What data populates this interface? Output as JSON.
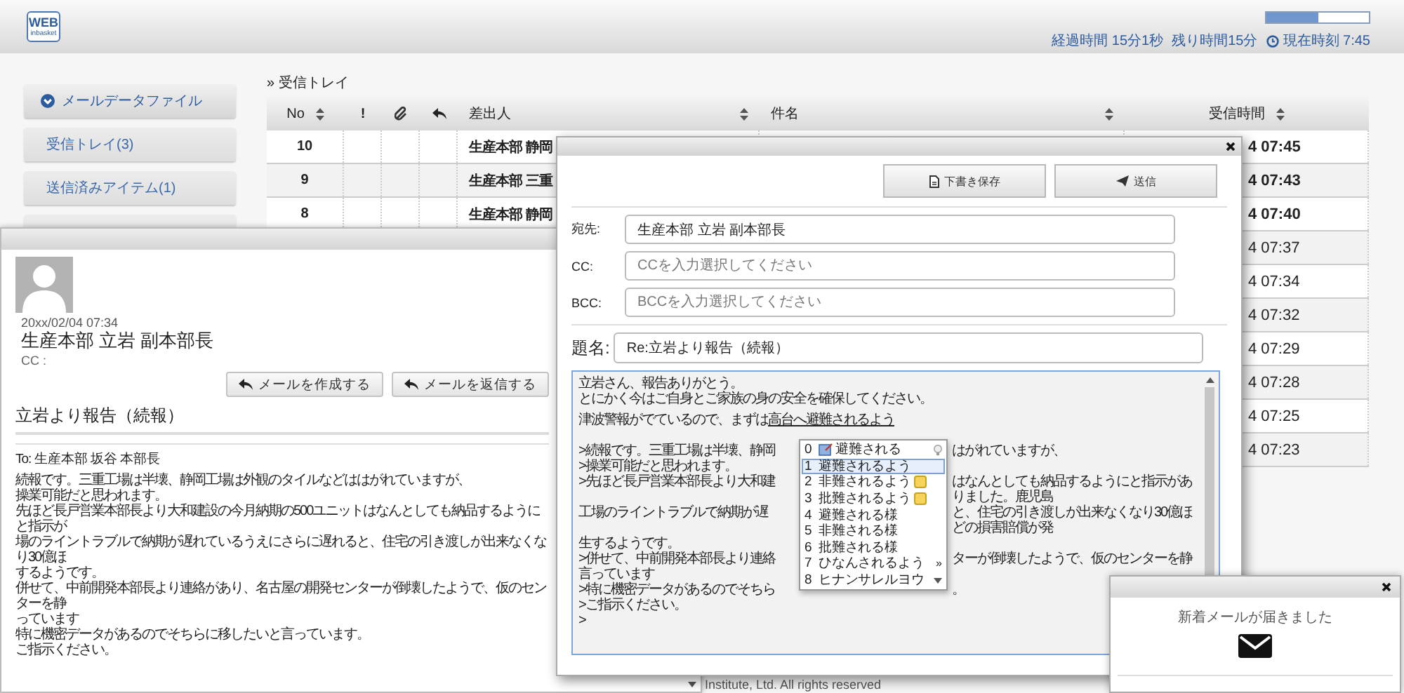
{
  "header": {
    "logo": {
      "line_1": "WEB",
      "line_2": "inbasket"
    },
    "progress": {
      "level": 0.5
    },
    "elapsed": "経過時間 15分1秒",
    "remaining": "残り時間15分",
    "clock": "現在時刻 7:45"
  },
  "sidebar": {
    "items": [
      {
        "kind": "folder",
        "label": "メールデータファイル"
      },
      {
        "kind": "item",
        "label": "受信トレイ(3)"
      },
      {
        "kind": "item",
        "label": "送信済みアイテム(1)"
      },
      {
        "kind": "item"
      }
    ]
  },
  "inbox": {
    "breadcrumb": "» 受信トレイ",
    "columns": [
      {
        "kind": "text",
        "label": "No",
        "sortable": true
      },
      {
        "kind": "text",
        "label": "!",
        "sortable": false
      },
      {
        "kind": "attachment",
        "sortable": false
      },
      {
        "kind": "reply",
        "sortable": false
      },
      {
        "kind": "text",
        "label": "差出人",
        "sortable": true
      },
      {
        "kind": "text",
        "label": "件名",
        "sortable": true
      },
      {
        "kind": "text",
        "label": "受信時間",
        "sortable": true
      }
    ],
    "rows": [
      {
        "no": "10",
        "sender": "生産本部 静岡",
        "time": "4 07:45",
        "unread": true
      },
      {
        "no": "9",
        "sender": "生産本部 三重",
        "time": "4 07:43",
        "unread": true
      },
      {
        "no": "8",
        "sender": "生産本部 静岡",
        "time": "4 07:40",
        "unread": true
      },
      {
        "time": "4 07:37",
        "unread": false
      },
      {
        "time": "4 07:34",
        "unread": false
      },
      {
        "time": "4 07:32",
        "unread": false
      },
      {
        "time": "4 07:29",
        "unread": false
      },
      {
        "time": "4 07:28",
        "unread": false
      },
      {
        "time": "4 07:25",
        "unread": false
      },
      {
        "time": "4 07:23",
        "unread": false
      }
    ]
  },
  "mail_view": {
    "date": "20xx/02/04 07:34",
    "from": "生産本部 立岩 副本部長",
    "cc": "CC :",
    "buttons": [
      "メールを作成する",
      "メールを返信する"
    ],
    "subject": "立岩より報告（続報）",
    "to": "To: 生産本部 坂谷 本部長",
    "body": [
      "続報です。三重工場は半壊、静岡工場は外観のタイルなどははがれていますが、",
      "操業可能だと思われます。",
      "先ほど長戸営業本部長より大和建設の今月納期の500ユニットはなんとしても納品するようにと指示が",
      "場のライントラブルで納期が遅れているうえにさらに遅れると、住宅の引き渡しが出来なくなり30億ほ",
      "するようです。",
      "併せて、中前開発本部長より連絡があり、名古屋の開発センターが倒壊したようで、仮のセンターを静",
      "っています",
      "特に機密データがあるのでそちらに移したいと言っています。",
      "ご指示ください。"
    ]
  },
  "compose": {
    "actions": [
      {
        "kind": "draft",
        "label": "下書き保存"
      },
      {
        "kind": "send",
        "label": "送信"
      }
    ],
    "fields": [
      {
        "label": "宛先:",
        "value": "生産本部 立岩 副本部長"
      },
      {
        "label": "CC:",
        "placeholder": "CCを入力選択してください"
      },
      {
        "label": "BCC:",
        "placeholder": "BCCを入力選択してください"
      }
    ],
    "subject": {
      "label": "題名:",
      "value": "Re:立岩より報告（続報）"
    },
    "message": {
      "lines": [
        "立岩さん、報告ありがとう。",
        "とにかく今はご自身とご家族の身の安全を確保してください。"
      ],
      "typing": {
        "text": "津波警報がでているので、まずは",
        "composition": "高台へ避難されるよう"
      },
      "quoted": [
        {
          "left": ">続報です。三重工場は半壊、静岡",
          "right": "はがれていますが、"
        },
        {
          "left": ">操業可能だと思われます。"
        },
        {
          "left": ">先ほど長戸営業本部長より大和建",
          "right": "はなんとしても納品するようにと指示がありました。鹿児島"
        },
        {
          "left": "工場のライントラブルで納期が遅",
          "right": "と、住宅の引き渡しが出来なくなり30億ほどの損害賠償が発"
        },
        {
          "left": "生するようです。"
        },
        {
          "left": ">併せて、中前開発本部長より連絡",
          "right": "ターが倒壊したようで、仮のセンターを静"
        },
        {
          "left": "言っています"
        },
        {
          "left": ">特に機密データがあるのでそちら",
          "right": "。"
        },
        {
          "left": ">ご指示ください。"
        },
        {
          "left": ">"
        }
      ]
    },
    "candidates": {
      "items": [
        {
          "number": "0",
          "text": "避難される",
          "kind": "dictionary",
          "selected": false
        },
        {
          "number": "1",
          "text": "避難されるよう",
          "kind": "plain",
          "selected": true
        },
        {
          "number": "2",
          "text": "非難されるよう",
          "kind": "note",
          "selected": false
        },
        {
          "number": "3",
          "text": "批難されるよう",
          "kind": "note",
          "selected": false
        },
        {
          "number": "4",
          "text": "避難される様",
          "kind": "plain",
          "selected": false
        },
        {
          "number": "5",
          "text": "非難される様",
          "kind": "plain",
          "selected": false
        },
        {
          "number": "6",
          "text": "批難される様",
          "kind": "plain",
          "selected": false
        },
        {
          "number": "7",
          "text": "ひなんされるよう",
          "kind": "plain",
          "selected": false
        },
        {
          "number": "8",
          "text": "ヒナンサレルヨウ",
          "kind": "plain",
          "selected": false
        }
      ],
      "more": "»"
    }
  },
  "notification": {
    "message": "新着メールが届きました"
  },
  "footer": "Institute, Ltd. All rights reserved"
}
